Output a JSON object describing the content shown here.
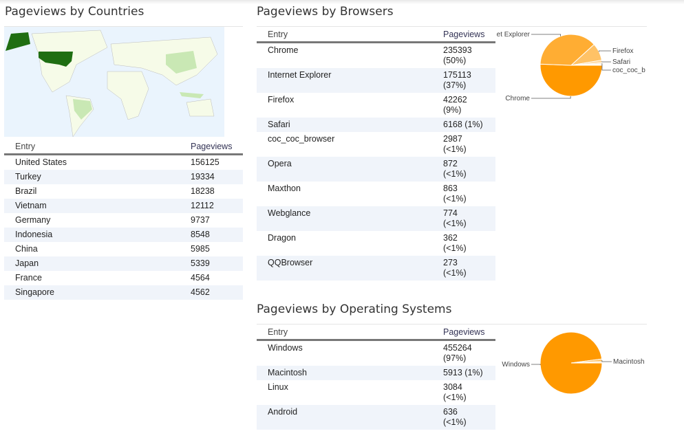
{
  "countries": {
    "title": "Pageviews by Countries",
    "headers": [
      "Entry",
      "Pageviews"
    ],
    "rows": [
      [
        "United States",
        "156125"
      ],
      [
        "Turkey",
        "19334"
      ],
      [
        "Brazil",
        "18238"
      ],
      [
        "Vietnam",
        "12112"
      ],
      [
        "Germany",
        "9737"
      ],
      [
        "Indonesia",
        "8548"
      ],
      [
        "China",
        "5985"
      ],
      [
        "Japan",
        "5339"
      ],
      [
        "France",
        "4564"
      ],
      [
        "Singapore",
        "4562"
      ]
    ]
  },
  "browsers": {
    "title": "Pageviews by Browsers",
    "headers": [
      "Entry",
      "Pageviews"
    ],
    "rows": [
      [
        "Chrome",
        "235393",
        "(50%)"
      ],
      [
        "Internet Explorer",
        "175113",
        "(37%)"
      ],
      [
        "Firefox",
        "42262",
        "(9%)"
      ],
      [
        "Safari",
        "6168 (1%)",
        ""
      ],
      [
        "coc_coc_browser",
        "2987",
        "(<1%)"
      ],
      [
        "Opera",
        "872",
        "(<1%)"
      ],
      [
        "Maxthon",
        "863",
        "(<1%)"
      ],
      [
        "Webglance",
        "774",
        "(<1%)"
      ],
      [
        "Dragon",
        "362",
        "(<1%)"
      ],
      [
        "QQBrowser",
        "273",
        "(<1%)"
      ]
    ],
    "pie_labels": [
      "Chrome",
      "et Explorer",
      "Firefox",
      "Safari",
      "coc_coc_b"
    ]
  },
  "os": {
    "title": "Pageviews by Operating Systems",
    "headers": [
      "Entry",
      "Pageviews"
    ],
    "rows": [
      [
        "Windows",
        "455264",
        "(97%)"
      ],
      [
        "Macintosh",
        "5913 (1%)",
        ""
      ],
      [
        "Linux",
        "3084",
        "(<1%)"
      ],
      [
        "Android",
        "636",
        "(<1%)"
      ]
    ],
    "pie_labels": [
      "Windows",
      "Macintosh"
    ]
  },
  "chart_data": [
    {
      "type": "pie",
      "title": "Pageviews by Browsers",
      "labels": [
        "Chrome",
        "Internet Explorer",
        "Firefox",
        "Safari",
        "coc_coc_browser",
        "Opera",
        "Maxthon",
        "Webglance",
        "Dragon",
        "QQBrowser"
      ],
      "values": [
        235393,
        175113,
        42262,
        6168,
        2987,
        872,
        863,
        774,
        362,
        273
      ],
      "colors": [
        "#ff9900",
        "#ffad33",
        "#ffc266",
        "#ffd699",
        "#ffe0b3",
        "#ffe6c2",
        "#ffeacc",
        "#ffedd5",
        "#fff0dd",
        "#fff3e5"
      ]
    },
    {
      "type": "pie",
      "title": "Pageviews by Operating Systems",
      "labels": [
        "Windows",
        "Macintosh",
        "Linux",
        "Android"
      ],
      "values": [
        455264,
        5913,
        3084,
        636
      ],
      "colors": [
        "#ff9900",
        "#ffc266",
        "#ffd699",
        "#ffe6c2"
      ]
    }
  ],
  "colors": {
    "map_ocean": "#eaf4fd",
    "map_land": "#f6fbe8",
    "map_high": "#1f6e12",
    "map_mid": "#c9e8b4"
  }
}
